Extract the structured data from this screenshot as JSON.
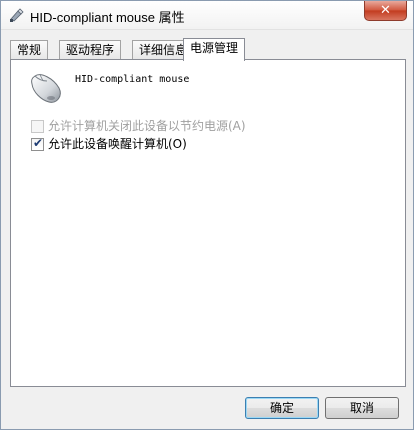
{
  "window": {
    "title": "HID-compliant mouse 属性",
    "close_label": "✕"
  },
  "tabs": [
    {
      "label": "常规",
      "active": false
    },
    {
      "label": "驱动程序",
      "active": false
    },
    {
      "label": "详细信息",
      "active": false
    },
    {
      "label": "电源管理",
      "active": true
    }
  ],
  "device": {
    "icon": "mouse-icon",
    "name": "HID-compliant mouse"
  },
  "options": [
    {
      "label": "允许计算机关闭此设备以节约电源(A)",
      "checked": false,
      "enabled": false
    },
    {
      "label": "允许此设备唤醒计算机(O)",
      "checked": true,
      "enabled": true
    }
  ],
  "buttons": {
    "ok_label": "确定",
    "cancel_label": "取消"
  }
}
